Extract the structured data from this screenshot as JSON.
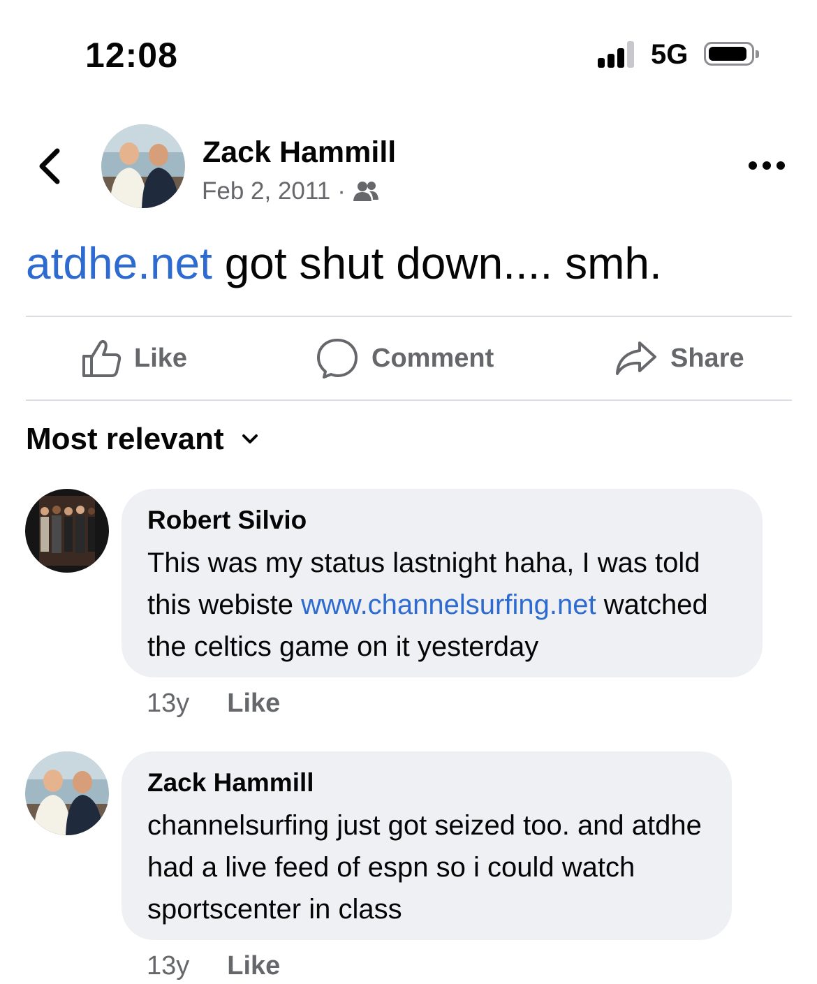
{
  "status_bar": {
    "time": "12:08",
    "network": "5G"
  },
  "post": {
    "author": "Zack Hammill",
    "date": "Feb 2, 2011",
    "separator": "·",
    "audience_icon": "friends-icon",
    "link_text": "atdhe.net",
    "text": " got shut down.... smh."
  },
  "actions": {
    "like": "Like",
    "comment": "Comment",
    "share": "Share"
  },
  "sort": {
    "label": "Most relevant"
  },
  "comments": [
    {
      "author": "Robert Silvio",
      "text_before_link": "This was my status lastnight haha, I was told this webiste ",
      "link": "www.channelsurfing.net",
      "text_after_link": " watched the celtics game on it yesterday",
      "time": "13y",
      "like_label": "Like"
    },
    {
      "author": "Zack Hammill",
      "text": "channelsurfing just got seized too. and atdhe had a live feed of espn so i could watch sportscenter in class",
      "time": "13y",
      "like_label": "Like"
    }
  ],
  "colors": {
    "link": "#2d6bd0",
    "secondary_text": "#65676b",
    "bubble": "#eff0f3"
  }
}
